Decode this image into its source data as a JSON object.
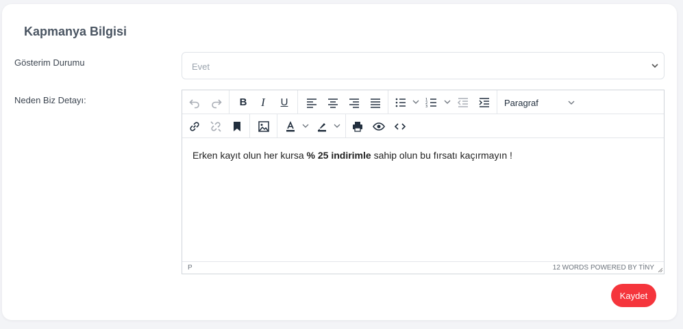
{
  "card": {
    "title": "Kapmanya Bilgisi"
  },
  "form": {
    "display_label": "Gösterim Durumu",
    "display_value": "Evet",
    "detail_label": "Neden Biz Detayı:"
  },
  "toolbar": {
    "bold": "B",
    "italic": "I",
    "underline": "U",
    "format_value": "Paragraf"
  },
  "editor": {
    "text_before": "Erken kayıt olun her kursa ",
    "text_bold": "% 25 indirimle",
    "text_after": " sahip olun bu fırsatı kaçırmayın !"
  },
  "status": {
    "path": "P",
    "words": "12 WORDS",
    "brand": "POWERED BY TİNY"
  },
  "actions": {
    "save_label": "Kaydet"
  },
  "colors": {
    "accent": "#f5353c",
    "icon": "#222f3e"
  }
}
